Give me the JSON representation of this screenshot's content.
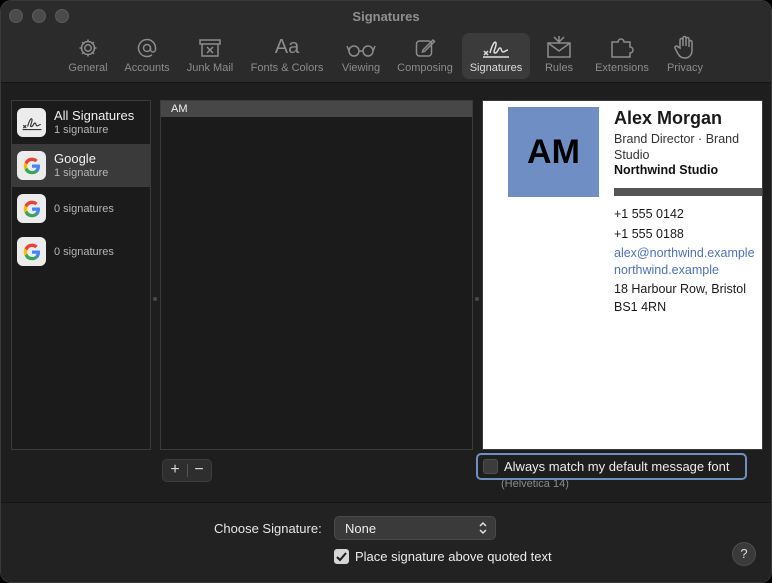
{
  "window": {
    "title": "Signatures"
  },
  "toolbar": {
    "tabs": [
      {
        "label": "General",
        "icon": "gear-icon"
      },
      {
        "label": "Accounts",
        "icon": "at-icon"
      },
      {
        "label": "Junk Mail",
        "icon": "junk-tray-icon"
      },
      {
        "label": "Fonts & Colors",
        "icon": "aa-font-icon"
      },
      {
        "label": "Viewing",
        "icon": "glasses-icon"
      },
      {
        "label": "Composing",
        "icon": "compose-icon"
      },
      {
        "label": "Signatures",
        "icon": "signature-icon"
      },
      {
        "label": "Rules",
        "icon": "rules-envelope-icon"
      },
      {
        "label": "Extensions",
        "icon": "puzzle-icon"
      },
      {
        "label": "Privacy",
        "icon": "hand-icon"
      }
    ],
    "active_tab": "Signatures"
  },
  "accounts": [
    {
      "name": "All Signatures",
      "count": "1 signature",
      "icon": "signature-icon"
    },
    {
      "name": "Google",
      "count": "1 signature",
      "icon": "google-icon",
      "selected": true
    },
    {
      "name": "",
      "count": "0 signatures",
      "icon": "google-icon"
    },
    {
      "name": "",
      "count": "0 signatures",
      "icon": "google-icon"
    }
  ],
  "signatures": [
    {
      "name": "AM"
    }
  ],
  "preview": {
    "initials": "AM",
    "name": "Alex Morgan",
    "role": "Brand Director · Brand Studio",
    "company": "Northwind Studio",
    "phone1": "+1 555 0142",
    "phone2": "+1 555 0188",
    "email": "alex@northwind.example",
    "website": "northwind.example",
    "address_line1": "18 Harbour Row, Bristol",
    "address_line2": "BS1 4RN",
    "avatar_color": "#6f8fc4",
    "link_color": "#4d72b8"
  },
  "controls": {
    "add_label": "+",
    "remove_label": "−",
    "match_font_label": "Always match my default message font",
    "match_font_checked": false,
    "font_note": "(Helvetica 14)"
  },
  "footer": {
    "choose_label": "Choose Signature:",
    "choose_value": "None",
    "place_above_label": "Place signature above quoted text",
    "place_above_checked": true,
    "help_label": "?"
  }
}
